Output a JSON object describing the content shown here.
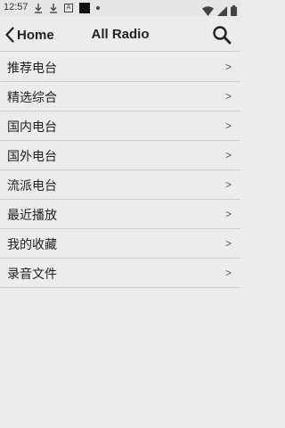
{
  "status_bar": {
    "time": "12:57",
    "icons": [
      "download-icon",
      "download-icon",
      "a-badge-icon",
      "black-square-icon",
      "dot-icon",
      "wifi-icon",
      "signal-icon",
      "battery-icon"
    ]
  },
  "header": {
    "back_label": "Home",
    "title": "All Radio",
    "search_icon": "search-icon"
  },
  "list": {
    "items": [
      {
        "label": "推荐电台",
        "chevron": ">"
      },
      {
        "label": "精选综合",
        "chevron": ">"
      },
      {
        "label": "国内电台",
        "chevron": ">"
      },
      {
        "label": "国外电台",
        "chevron": ">"
      },
      {
        "label": "流派电台",
        "chevron": ">"
      },
      {
        "label": "最近播放",
        "chevron": ">"
      },
      {
        "label": "我的收藏",
        "chevron": ">"
      },
      {
        "label": "录音文件",
        "chevron": ">"
      }
    ]
  },
  "colors": {
    "background": "#ececec",
    "divider": "#cfcfcf",
    "text": "#222222"
  }
}
